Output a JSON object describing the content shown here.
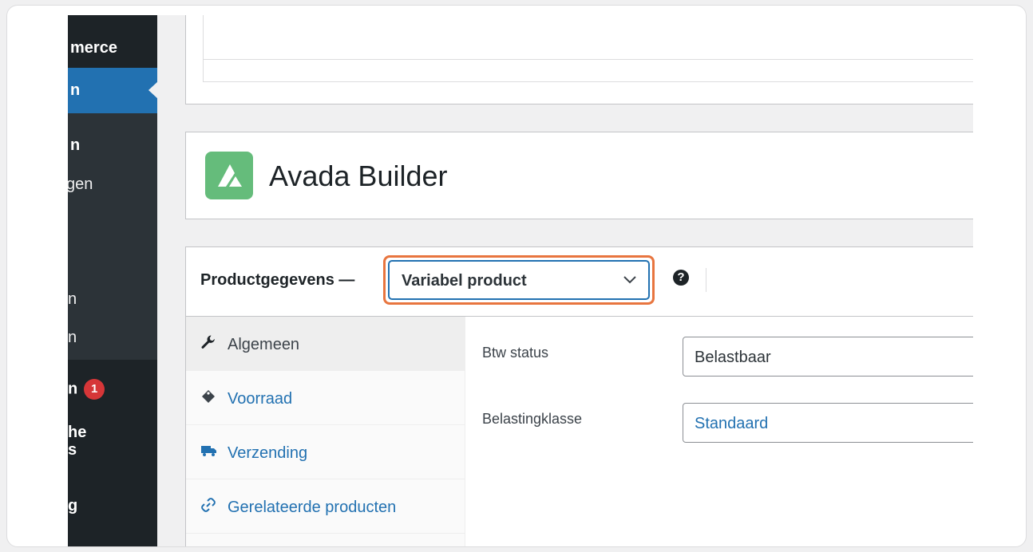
{
  "sidebar": {
    "items": [
      {
        "label": "merce"
      },
      {
        "label": "n"
      },
      {
        "label": "n"
      },
      {
        "label": "gen"
      },
      {
        "label": "n"
      },
      {
        "label": "n"
      },
      {
        "label": "n"
      },
      {
        "label": "he"
      },
      {
        "label": "s"
      },
      {
        "label": "g"
      }
    ],
    "badge_count": "1"
  },
  "avada": {
    "title": "Avada Builder"
  },
  "product_data": {
    "label": "Productgegevens —",
    "product_type": "Variabel product",
    "help_icon": "?"
  },
  "tabs": [
    {
      "label": "Algemeen",
      "icon": "wrench-icon"
    },
    {
      "label": "Voorraad",
      "icon": "tag-icon"
    },
    {
      "label": "Verzending",
      "icon": "truck-icon"
    },
    {
      "label": "Gerelateerde producten",
      "icon": "link-icon"
    }
  ],
  "fields": {
    "tax_status": {
      "label": "Btw status",
      "value": "Belastbaar"
    },
    "tax_class": {
      "label": "Belastingklasse",
      "value": "Standaard"
    }
  },
  "colors": {
    "sidebar_bg": "#1d2327",
    "sidebar_active": "#2271b1",
    "highlight": "#e8753f",
    "avada_green": "#65bc7b",
    "link_blue": "#2271b1",
    "badge_red": "#d63638"
  }
}
